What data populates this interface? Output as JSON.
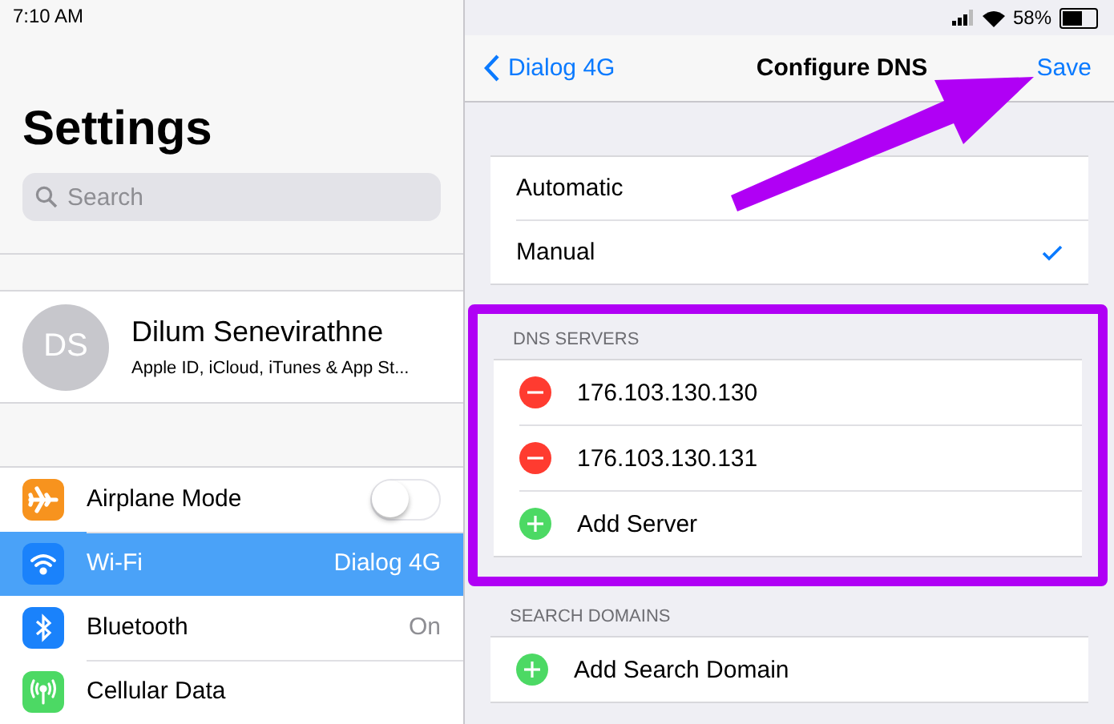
{
  "status_bar": {
    "time": "7:10 AM",
    "battery": "58%"
  },
  "sidebar": {
    "title": "Settings",
    "search": {
      "placeholder": "Search"
    },
    "profile": {
      "initials": "DS",
      "name": "Dilum Senevirathne",
      "subtitle": "Apple ID, iCloud, iTunes & App St..."
    },
    "items": [
      {
        "kind": "toggle",
        "label": "Airplane Mode",
        "on": false,
        "selected": false,
        "color": "#f7931e"
      },
      {
        "kind": "value",
        "label": "Wi-Fi",
        "value": "Dialog 4G",
        "selected": true,
        "color": "#1a82fb"
      },
      {
        "kind": "value",
        "label": "Bluetooth",
        "value": "On",
        "selected": false,
        "color": "#1a82fb"
      },
      {
        "kind": "plain",
        "label": "Cellular Data",
        "selected": false,
        "color": "#4cd964"
      }
    ]
  },
  "detail": {
    "nav": {
      "back": "Dialog 4G",
      "title": "Configure DNS",
      "action": "Save"
    },
    "modes": [
      {
        "label": "Automatic",
        "selected": false
      },
      {
        "label": "Manual",
        "selected": true
      }
    ],
    "dns_servers": {
      "header": "DNS SERVERS",
      "items": [
        {
          "kind": "remove",
          "label": "176.103.130.130"
        },
        {
          "kind": "remove",
          "label": "176.103.130.131"
        },
        {
          "kind": "add",
          "label": "Add Server"
        }
      ]
    },
    "search_domains": {
      "header": "SEARCH DOMAINS",
      "items": [
        {
          "kind": "add",
          "label": "Add Search Domain"
        }
      ]
    }
  }
}
